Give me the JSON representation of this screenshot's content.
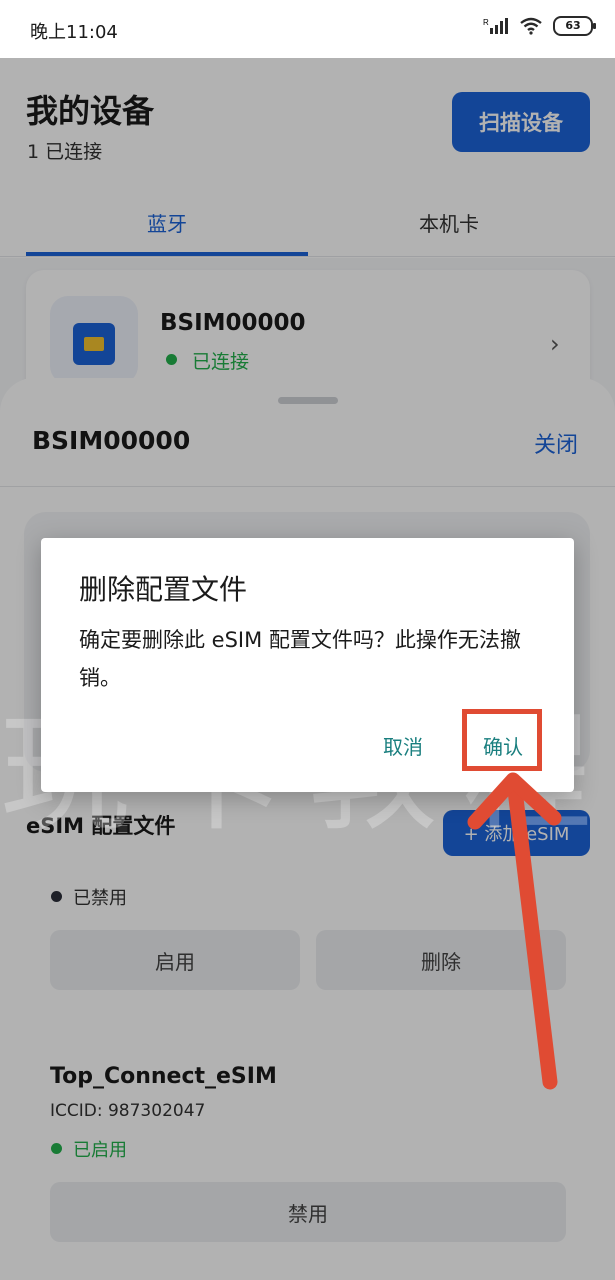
{
  "status_bar": {
    "time": "晚上11:04",
    "battery": "63"
  },
  "page": {
    "title": "我的设备",
    "subtitle": "1 已连接",
    "scan_button": "扫描设备",
    "tabs": [
      {
        "label": "蓝牙",
        "active": true
      },
      {
        "label": "本机卡",
        "active": false
      }
    ]
  },
  "device": {
    "name": "BSIM00000",
    "status": "已连接"
  },
  "sheet": {
    "title": "BSIM00000",
    "close_label": "关闭",
    "esim_header": "eSIM 配置文件",
    "add_button": "+ 添加 eSIM",
    "profiles": [
      {
        "status": "已禁用",
        "buttons": [
          "启用",
          "删除"
        ]
      },
      {
        "name": "Top_Connect_eSIM",
        "iccid": "ICCID: 987302047",
        "status": "已启用",
        "button": "禁用"
      }
    ]
  },
  "dialog": {
    "title": "删除配置文件",
    "message": "确定要删除此 eSIM 配置文件吗？此操作无法撤销。",
    "cancel": "取消",
    "confirm": "确认"
  },
  "watermark": "玩卡教程",
  "colors": {
    "accent": "#1c63d8",
    "success": "#23b14d",
    "dialog_button": "#1a7f7f",
    "annotation": "#e04b33"
  }
}
